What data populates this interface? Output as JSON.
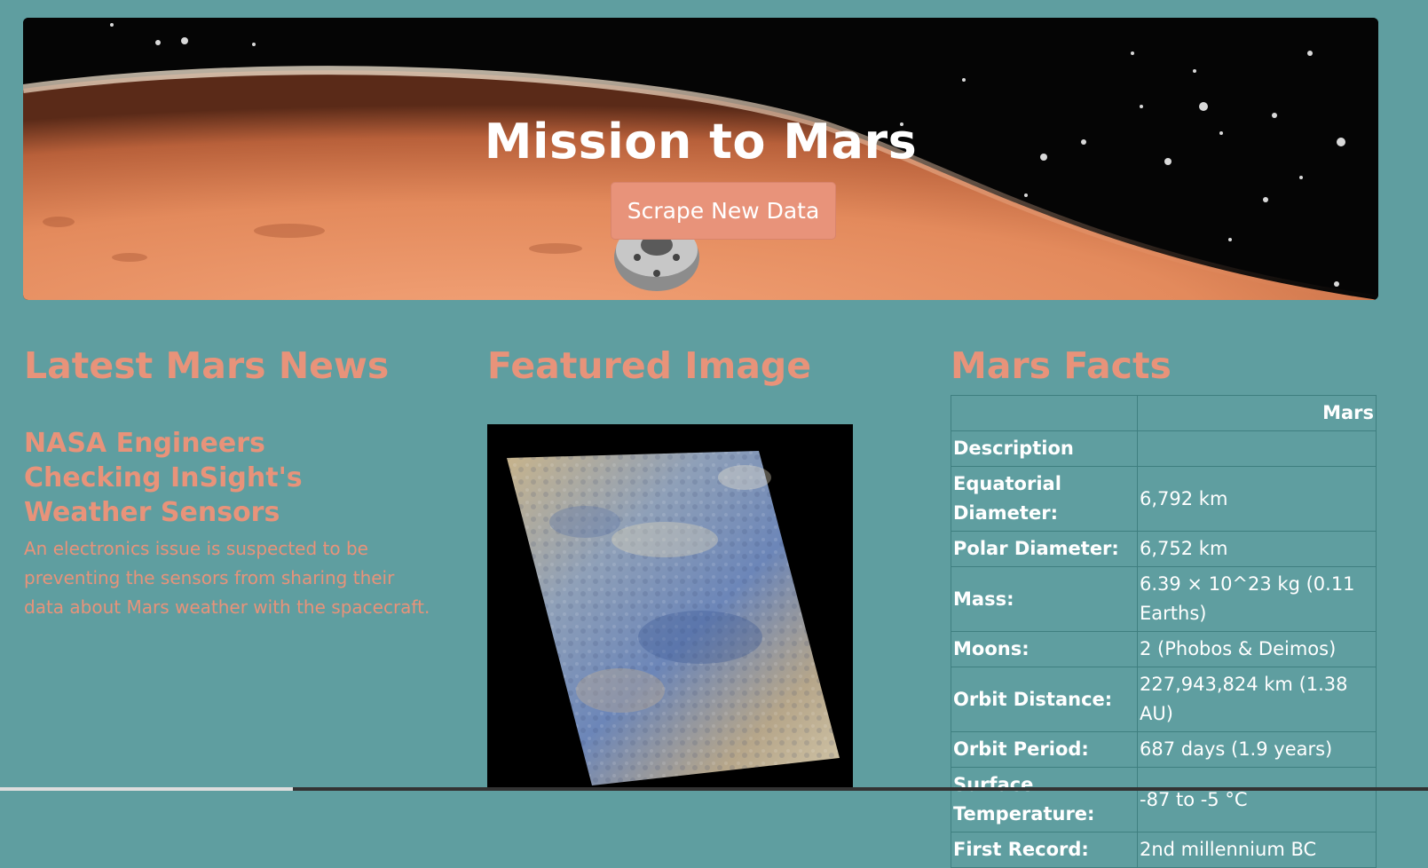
{
  "hero": {
    "title": "Mission to Mars",
    "button_label": "Scrape New Data"
  },
  "news": {
    "heading": "Latest Mars News",
    "title": "NASA Engineers Checking InSight's Weather Sensors",
    "paragraph": "An electronics issue is suspected to be preventing the sensors from sharing their data about Mars weather with the spacecraft."
  },
  "featured": {
    "heading": "Featured Image"
  },
  "facts": {
    "heading": "Mars Facts",
    "column_header": "Mars",
    "rows": [
      {
        "key": "Description",
        "value": ""
      },
      {
        "key": "Equatorial Diameter:",
        "value": "6,792 km"
      },
      {
        "key": "Polar Diameter:",
        "value": "6,752 km"
      },
      {
        "key": "Mass:",
        "value": "6.39 × 10^23 kg (0.11 Earths)"
      },
      {
        "key": "Moons:",
        "value": "2 (Phobos & Deimos)"
      },
      {
        "key": "Orbit Distance:",
        "value": "227,943,824 km (1.38 AU)"
      },
      {
        "key": "Orbit Period:",
        "value": "687 days (1.9 years)"
      },
      {
        "key": "Surface Temperature:",
        "value": "-87 to -5 °C"
      },
      {
        "key": "First Record:",
        "value": "2nd millennium BC"
      }
    ]
  },
  "colors": {
    "background": "#5f9ea0",
    "accent": "#e8937a"
  }
}
